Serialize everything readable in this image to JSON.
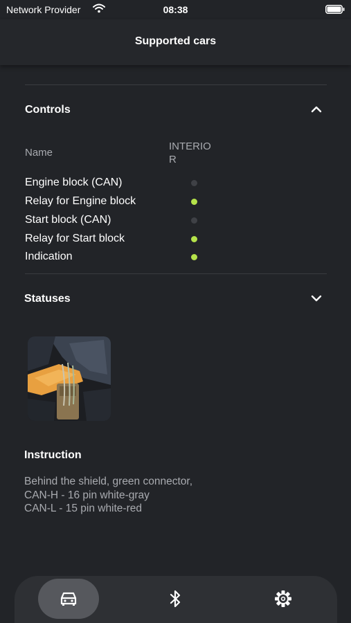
{
  "status_bar": {
    "carrier": "Network Provider",
    "time": "08:38"
  },
  "header": {
    "title": "Supported cars"
  },
  "controls": {
    "title": "Controls",
    "name_header": "Name",
    "column_header": "INTERIOR",
    "rows": [
      {
        "label": "Engine block (CAN)",
        "status": "inactive"
      },
      {
        "label": "Relay for Engine block",
        "status": "active"
      },
      {
        "label": "Start block (CAN)",
        "status": "inactive"
      },
      {
        "label": "Relay for Start block",
        "status": "active"
      },
      {
        "label": "Indication",
        "status": "active"
      }
    ]
  },
  "statuses": {
    "title": "Statuses"
  },
  "instruction": {
    "title": "Instruction",
    "lines": [
      "Behind the shield, green connector,",
      "CAN-H - 16 pin white-gray",
      "CAN-L - 15 pin white-red"
    ]
  },
  "nav": {
    "items": [
      {
        "icon": "car-icon",
        "active": true
      },
      {
        "icon": "bluetooth-icon",
        "active": false
      },
      {
        "icon": "gear-icon",
        "active": false
      }
    ]
  },
  "colors": {
    "background": "#222428",
    "active_dot": "#b5e34a",
    "inactive_dot": "#3f4146",
    "muted_text": "#a9abb0"
  }
}
